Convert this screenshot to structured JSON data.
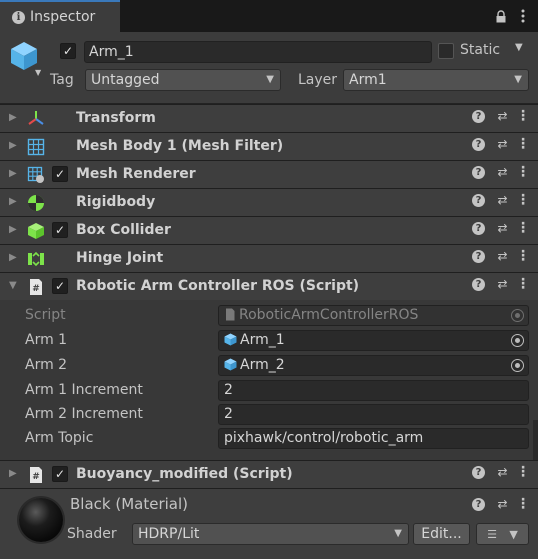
{
  "window": {
    "tab_label": "Inspector",
    "tab_icon": "info-icon",
    "tools": [
      "lock-icon",
      "kebab-menu-icon"
    ]
  },
  "header": {
    "active": true,
    "name": "Arm_1",
    "static_label": "Static",
    "static_checked": false,
    "tag_label": "Tag",
    "tag_value": "Untagged",
    "layer_label": "Layer",
    "layer_value": "Arm1"
  },
  "components": [
    {
      "name": "Transform",
      "icon": "transform-icon",
      "has_checkbox": false,
      "expanded": false
    },
    {
      "name": "Mesh Body 1 (Mesh Filter)",
      "icon": "mesh-filter-icon",
      "has_checkbox": false,
      "expanded": false
    },
    {
      "name": "Mesh Renderer",
      "icon": "mesh-renderer-icon",
      "has_checkbox": true,
      "checked": true,
      "expanded": false
    },
    {
      "name": "Rigidbody",
      "icon": "rigidbody-icon",
      "has_checkbox": false,
      "expanded": false
    },
    {
      "name": "Box Collider",
      "icon": "box-collider-icon",
      "has_checkbox": true,
      "checked": true,
      "expanded": false
    },
    {
      "name": "Hinge Joint",
      "icon": "hinge-joint-icon",
      "has_checkbox": false,
      "expanded": false
    },
    {
      "name": "Robotic Arm Controller ROS (Script)",
      "icon": "script-icon",
      "has_checkbox": true,
      "checked": true,
      "expanded": true
    }
  ],
  "script_props": {
    "script_label": "Script",
    "script_value": "RoboticArmControllerROS",
    "arm1_label": "Arm 1",
    "arm1_value": "Arm_1",
    "arm2_label": "Arm 2",
    "arm2_value": "Arm_2",
    "arm1_inc_label": "Arm 1 Increment",
    "arm1_inc_value": "2",
    "arm2_inc_label": "Arm 2 Increment",
    "arm2_inc_value": "2",
    "topic_label": "Arm Topic",
    "topic_value": "pixhawk/control/robotic_arm"
  },
  "buoyancy": {
    "name": "Buoyancy_modified (Script)",
    "icon": "script-icon",
    "checked": true,
    "expanded": false
  },
  "material": {
    "name": "Black (Material)",
    "shader_label": "Shader",
    "shader_value": "HDRP/Lit",
    "edit_label": "Edit..."
  },
  "colors": {
    "panel_bg": "#383838",
    "header_bg": "#3e3e3e",
    "field_bg": "#2a2a2a",
    "accent": "#3a79bb",
    "cube_icon": "#56b4e9",
    "collider_green": "#7de34a"
  }
}
